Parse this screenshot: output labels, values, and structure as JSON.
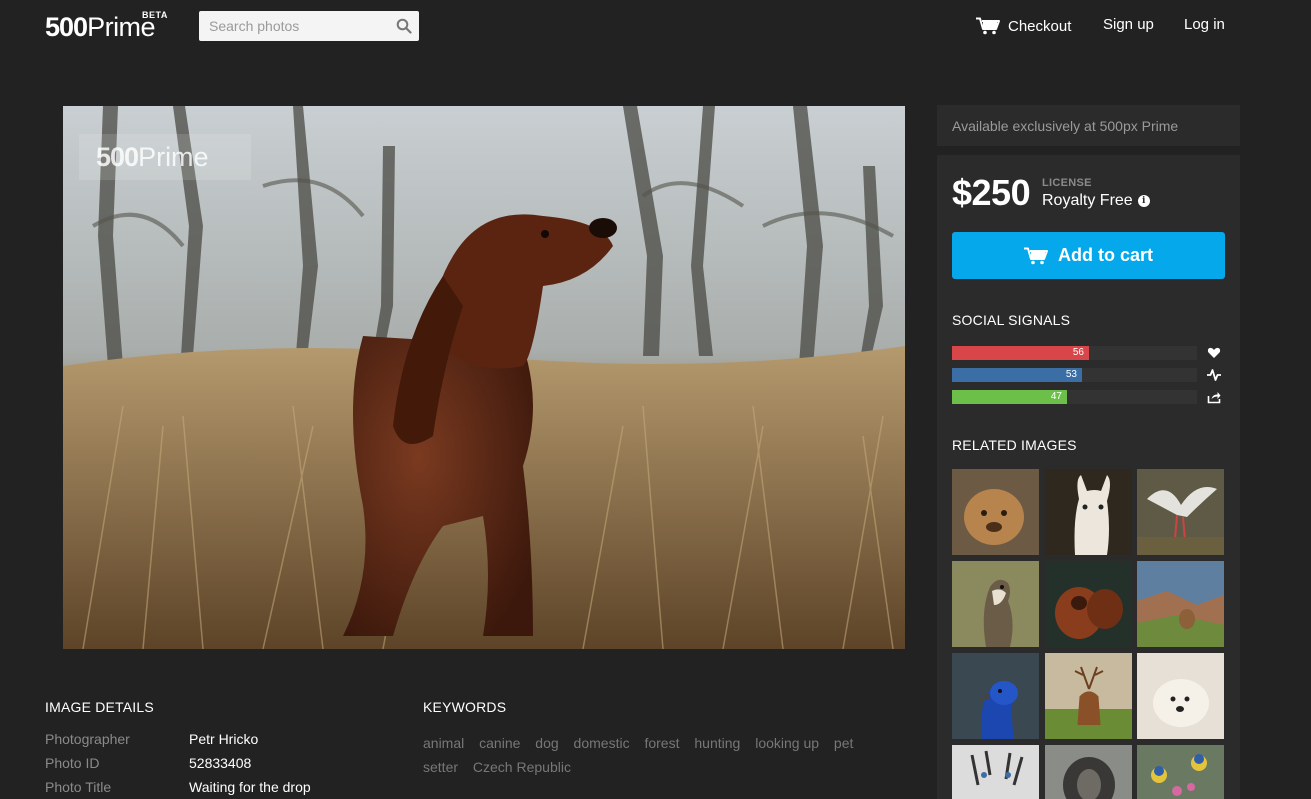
{
  "header": {
    "logo_num": "500",
    "logo_word": "Prime",
    "logo_badge": "BETA",
    "search_placeholder": "Search photos",
    "checkout_label": "Checkout",
    "signup_label": "Sign up",
    "login_label": "Log in"
  },
  "photo": {
    "watermark_num": "500",
    "watermark_word": "Prime"
  },
  "sidebar": {
    "exclusive_text": "Available exclusively at 500px Prime",
    "price": "$250",
    "license_label": "LICENSE",
    "license_value": "Royalty Free",
    "add_to_cart_label": "Add to cart",
    "social_title": "SOCIAL SIGNALS",
    "signals": [
      {
        "value": "56",
        "fraction": 0.56,
        "color": "#d9464a",
        "icon": "heart-icon"
      },
      {
        "value": "53",
        "fraction": 0.53,
        "color": "#3a6ea5",
        "icon": "pulse-icon"
      },
      {
        "value": "47",
        "fraction": 0.47,
        "color": "#6cc04a",
        "icon": "share-icon"
      }
    ],
    "related_title": "RELATED IMAGES"
  },
  "details": {
    "title": "IMAGE DETAILS",
    "rows": [
      {
        "label": "Photographer",
        "value": "Petr Hricko"
      },
      {
        "label": "Photo ID",
        "value": "52833408"
      },
      {
        "label": "Photo Title",
        "value": "Waiting for the drop"
      }
    ]
  },
  "keywords": {
    "title": "KEYWORDS",
    "items": [
      "animal",
      "canine",
      "dog",
      "domestic",
      "forest",
      "hunting",
      "looking up",
      "pet",
      "setter",
      "Czech Republic"
    ]
  }
}
